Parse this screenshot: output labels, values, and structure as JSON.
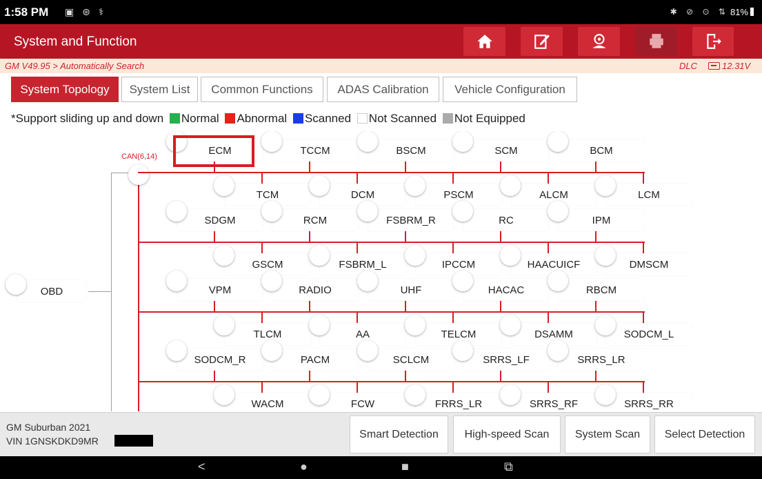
{
  "status_bar": {
    "time": "1:58 PM",
    "battery": "81%"
  },
  "title_bar": {
    "title": "System and Function"
  },
  "breadcrumb": {
    "path": "GM V49.95 > Automatically Search",
    "dlc": "DLC",
    "voltage": "12.31V"
  },
  "tabs": [
    {
      "label": "System Topology",
      "active": true
    },
    {
      "label": "System List",
      "active": false
    },
    {
      "label": "Common Functions",
      "active": false
    },
    {
      "label": "ADAS Calibration",
      "active": false
    },
    {
      "label": "Vehicle Configuration",
      "active": false
    }
  ],
  "legend": {
    "intro": "*Support sliding up and down",
    "items": [
      {
        "label": "Normal",
        "color": "#22b14c"
      },
      {
        "label": "Abnormal",
        "color": "#e2231a"
      },
      {
        "label": "Scanned",
        "color": "#1a3de8"
      },
      {
        "label": "Not Scanned",
        "color": "#ffffff"
      },
      {
        "label": "Not Equipped",
        "color": "#aaaaaa"
      }
    ]
  },
  "topology": {
    "root": "OBD",
    "bus_label": "CAN(6,14)",
    "highlighted": "ECM",
    "rows": [
      [
        "ECM",
        "TCCM",
        "BSCM",
        "SCM",
        "BCM"
      ],
      [
        "TCM",
        "DCM",
        "PSCM",
        "ALCM",
        "LCM"
      ],
      [
        "SDGM",
        "RCM",
        "FSBRM_R",
        "RC",
        "IPM"
      ],
      [
        "GSCM",
        "FSBRM_L",
        "IPCCM",
        "HAACUICF",
        "DMSCM"
      ],
      [
        "VPM",
        "RADIO",
        "UHF",
        "HACAC",
        "RBCM"
      ],
      [
        "TLCM",
        "AA",
        "TELCM",
        "DSAMM",
        "SODCM_L"
      ],
      [
        "SODCM_R",
        "PACM",
        "SCLCM",
        "SRRS_LF",
        "SRRS_LR"
      ],
      [
        "WACM",
        "FCW",
        "FRRS_LR",
        "SRRS_RF",
        "SRRS_RR"
      ]
    ]
  },
  "vehicle": {
    "name": "GM Suburban 2021",
    "vin": "VIN 1GNSKDKD9MR"
  },
  "actions": [
    "Smart Detection",
    "High-speed Scan",
    "System Scan",
    "Select Detection"
  ]
}
